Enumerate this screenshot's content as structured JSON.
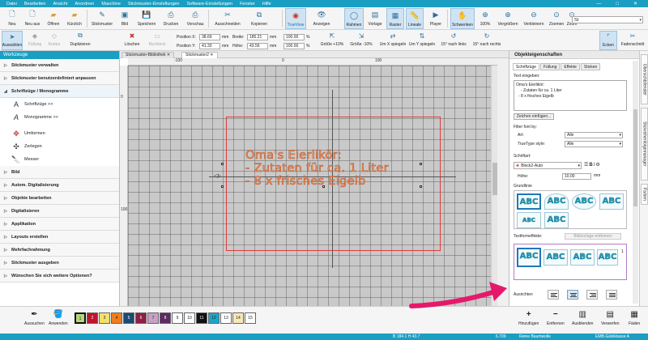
{
  "menu": [
    "Datei",
    "Bearbeiten",
    "Ansicht",
    "Anordnen",
    "Maschine",
    "Stickmuster-Einstellungen",
    "Software-Einstellungen",
    "Fenster",
    "Hilfe"
  ],
  "window_controls": {
    "minimize": "—",
    "maximize": "□",
    "close": "✕"
  },
  "toolbar1": {
    "buttons": [
      "Neu",
      "Neu aus",
      "Öffnen",
      "Kürzlich",
      "Stickmuster",
      "Bild",
      "Speichern",
      "Drucken",
      "Vorschau",
      "Ausschneiden",
      "Kopieren",
      "TrueView",
      "Anzeigen",
      "Rahmen",
      "Vorlage",
      "Raster",
      "Lineale",
      "Player",
      "Schwenken",
      "100%",
      "Vergrößern",
      "Verkleinern",
      "Zoomen",
      "Zoom"
    ],
    "design_select": "St"
  },
  "toolbar2": {
    "buttons": [
      "Auswählen",
      "Füllung",
      "Kontur",
      "Duplizieren",
      "Löschen",
      "Rechteck"
    ],
    "position_x_label": "Position X:",
    "position_x": "38.69",
    "position_y_label": "Position Y:",
    "position_y": "41.33",
    "width_label": "Breite:",
    "width": "185.21",
    "height_label": "Höhe:",
    "height": "43.56",
    "unit": "mm",
    "scale_x": "100.00",
    "scale_y": "100.00",
    "percent": "%",
    "transform_buttons": [
      "Größe +10%",
      "Größe -10%",
      "Um X spiegeln",
      "Um Y spiegeln",
      "15° nach links",
      "15° nach rechts"
    ],
    "right_buttons": [
      "Ecken",
      "Fadenschnitt"
    ]
  },
  "doc_tabs": [
    "Stickmuster-Bibliothek",
    "Stickmuster2"
  ],
  "left_panel": {
    "title": "Werkzeuge",
    "sections_top": [
      "Stickmuster verwalten",
      "Stickmuster benutzerdefiniert anpassen"
    ],
    "open_section": "Schriftzüge / Monogramme",
    "sub_group1": [
      "Schriftzüge >>",
      "Monogramme >>"
    ],
    "sub_group2": [
      "Umformen",
      "Zerlegen",
      "Messer"
    ],
    "sections_bottom": [
      "Bild",
      "Autom. Digitalisierung",
      "Objekte bearbeiten",
      "Digitalisieren",
      "Applikation",
      "Layouts erstellen",
      "Mehrfachrahmung",
      "Stickmuster ausgeben",
      "Wünschen Sie sich weitere Optionen?"
    ]
  },
  "canvas": {
    "ruler_h": [
      "-100",
      "0",
      "100"
    ],
    "ruler_v": [
      "0",
      "100"
    ],
    "embroidery_lines": [
      "Oma's Eierlikör:",
      "- Zutaten für ca. 1 Liter",
      "- 8 x frisches Eigelb"
    ],
    "text_fill_color": "#e2a071",
    "hoop_color": "#e03b3b"
  },
  "right_panel": {
    "title": "Objekteigenschaften",
    "tabs": [
      "Schriftzüge",
      "Füllung",
      "Effekte",
      "Sticken"
    ],
    "text_label": "Text eingeben:",
    "text_lines": [
      "Oma's Eierlikör:",
      "- Zutaten für ca. 1 Liter",
      "- 8 x frisches Eigelb"
    ],
    "insert_chars": "Zeichen einfügen...",
    "filter_label": "Filter font by:",
    "art_label": "Art:",
    "art_value": "Alle",
    "truetype_label": "TrueType style:",
    "truetype_value": "Alle",
    "font_label": "Schriftart:",
    "font_value": "Block2-Auto",
    "size_label": "Höhe:",
    "size_value": "10.00",
    "size_unit": "mm",
    "baseline_label": "Grundlinie",
    "shape_sample": "ABC",
    "effects_label": "Textformeffekte:",
    "effects_button": "Bildvorlage entfernen",
    "align_label": "Ausrichten",
    "effects_page": "1"
  },
  "side_tabs": [
    "Übersichtsfenster",
    "Stickreihenfolgemanager",
    "Farben"
  ],
  "bottom": {
    "tools": [
      "Aussuchen",
      "Anwenden"
    ],
    "swatches": [
      {
        "n": "1",
        "c": "#b7d77a"
      },
      {
        "n": "2",
        "c": "#c0162b"
      },
      {
        "n": "3",
        "c": "#f2e16b"
      },
      {
        "n": "4",
        "c": "#f07e1c"
      },
      {
        "n": "5",
        "c": "#1b4a73"
      },
      {
        "n": "6",
        "c": "#8e1f47"
      },
      {
        "n": "7",
        "c": "#c8a0c8"
      },
      {
        "n": "8",
        "c": "#5e2a64"
      },
      {
        "n": "9",
        "c": "#ffffff"
      },
      {
        "n": "10",
        "c": "#ffffff"
      },
      {
        "n": "11",
        "c": "#111111"
      },
      {
        "n": "12",
        "c": "#1aa5c9"
      },
      {
        "n": "13",
        "c": "#ffffff"
      },
      {
        "n": "14",
        "c": "#f7e7b9"
      },
      {
        "n": "15",
        "c": "#ffffff"
      }
    ],
    "actions": [
      "Hinzufügen",
      "Entfernen",
      "Ausblenden",
      "Verwerfen",
      "Fäden"
    ]
  },
  "status": {
    "dimensions": "B 184.1 H 43.7",
    "stitch_count": "6.709",
    "thread_type": "Reine Baumwolle",
    "thread_brand": "EMB-Gütéklasse A"
  }
}
